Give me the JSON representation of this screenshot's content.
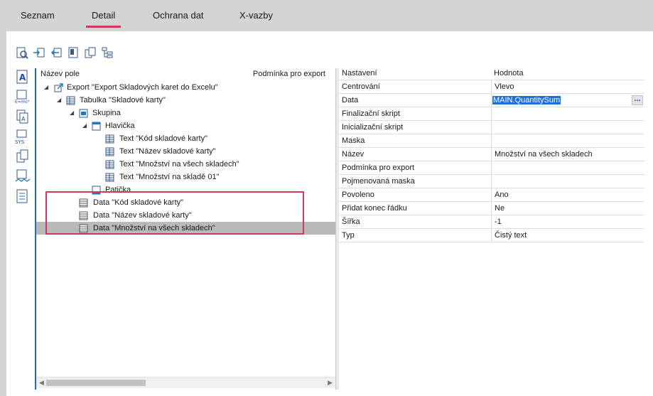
{
  "tabs": {
    "seznam": "Seznam",
    "detail": "Detail",
    "ochrana": "Ochrana dat",
    "xvazby": "X-vazby"
  },
  "tree": {
    "col1": "Název pole",
    "col2": "Podmínka pro export",
    "rows": [
      "Export \"Export Skladových karet do Excelu\"",
      "Tabulka \"Skladové karty\"",
      "Skupina",
      "Hlavička",
      "Text \"Kód skladové karty\"",
      "Text \"Název skladové karty\"",
      "Text \"Množství na všech skladech\"",
      "Text \"Množství na skladě 01\"",
      "Patička",
      "Data \"Kód skladové karty\"",
      "Data \"Název skladové karty\"",
      "Data \"Množství na všech skladech\""
    ]
  },
  "props": {
    "col1": "Nastavení",
    "col2": "Hodnota",
    "rows": [
      {
        "k": "Centrování",
        "v": "Vlevo"
      },
      {
        "k": "Data",
        "v": "MAIN.QuantitySum"
      },
      {
        "k": "Finalizační skript",
        "v": ""
      },
      {
        "k": "Inicializační skript",
        "v": ""
      },
      {
        "k": "Maska",
        "v": ""
      },
      {
        "k": "Název",
        "v": "Množství na všech skladech"
      },
      {
        "k": "Podmínka pro export",
        "v": ""
      },
      {
        "k": "Pojmenovaná maska",
        "v": ""
      },
      {
        "k": "Povoleno",
        "v": "Ano"
      },
      {
        "k": "Přidat konec řádku",
        "v": "Ne"
      },
      {
        "k": "Šířka",
        "v": "-1"
      },
      {
        "k": "Typ",
        "v": "Čistý text"
      }
    ],
    "ellipsis": "..."
  },
  "colors": {
    "accent": "#d2385a",
    "selection": "#1e6fd6",
    "tree_border": "#1e6fb8"
  }
}
